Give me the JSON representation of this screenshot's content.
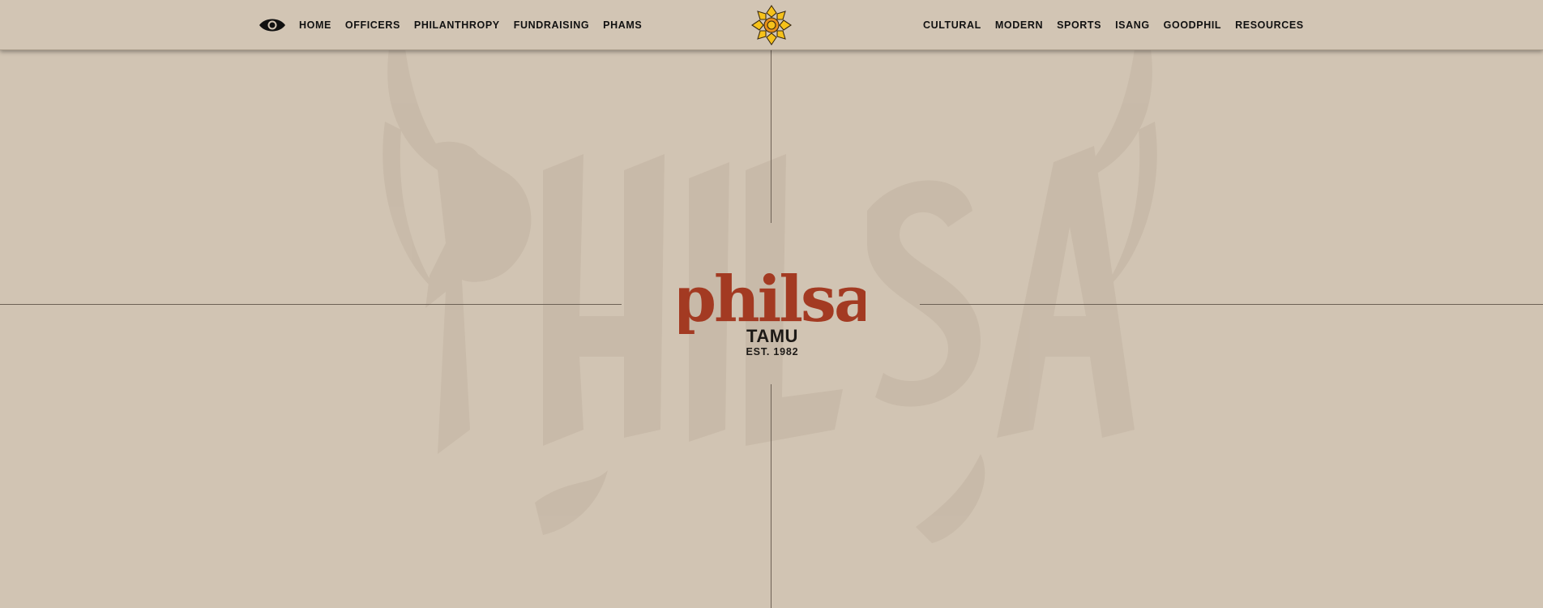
{
  "colors": {
    "background": "#d1c4b3",
    "watermark": "#c6b8a6",
    "brand_red": "#a33a22",
    "sun_yellow": "#f6c21a",
    "sun_orange": "#e8901a",
    "text_dark": "#111111"
  },
  "header": {
    "menu_icon": "eye-icon",
    "nav_left": [
      {
        "label": "HOME"
      },
      {
        "label": "OFFICERS"
      },
      {
        "label": "PHILANTHROPY"
      },
      {
        "label": "FUNDRAISING"
      },
      {
        "label": "PHAMS"
      }
    ],
    "center_icon": "sun-flower-logo-icon",
    "nav_right": [
      {
        "label": "CULTURAL"
      },
      {
        "label": "MODERN"
      },
      {
        "label": "SPORTS"
      },
      {
        "label": "ISANG"
      },
      {
        "label": "GOODPHIL"
      },
      {
        "label": "RESOURCES"
      }
    ]
  },
  "hero": {
    "watermark_text": "PHILSA",
    "wordmark": "philsa",
    "subtitle": "TAMU",
    "established": "EST. 1982"
  }
}
